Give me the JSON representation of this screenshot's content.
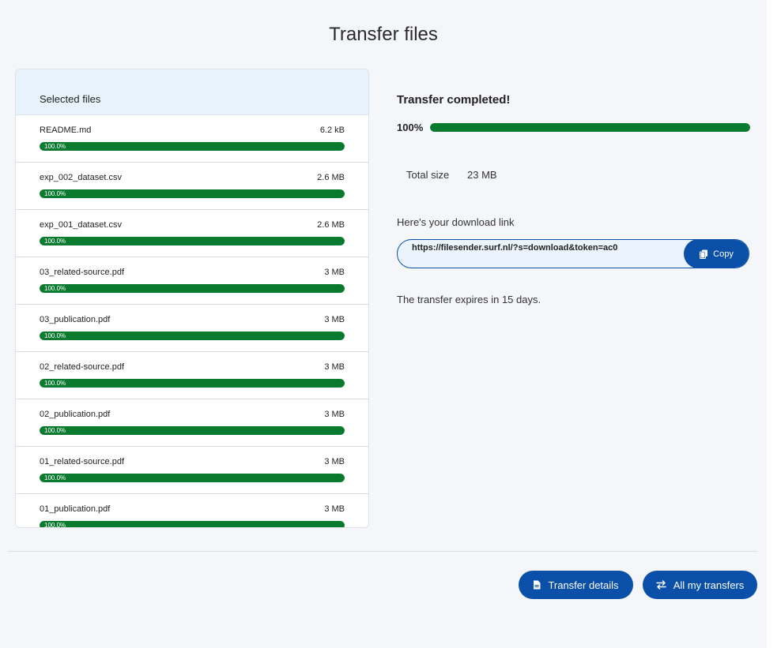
{
  "page": {
    "title": "Transfer files"
  },
  "files_panel": {
    "header": "Selected files",
    "files": [
      {
        "name": "README.md",
        "size": "6.2 kB",
        "progress_label": "100.0%",
        "progress": 1.0
      },
      {
        "name": "exp_002_dataset.csv",
        "size": "2.6 MB",
        "progress_label": "100.0%",
        "progress": 1.0
      },
      {
        "name": "exp_001_dataset.csv",
        "size": "2.6 MB",
        "progress_label": "100.0%",
        "progress": 1.0
      },
      {
        "name": "03_related-source.pdf",
        "size": "3 MB",
        "progress_label": "100.0%",
        "progress": 1.0
      },
      {
        "name": "03_publication.pdf",
        "size": "3 MB",
        "progress_label": "100.0%",
        "progress": 1.0
      },
      {
        "name": "02_related-source.pdf",
        "size": "3 MB",
        "progress_label": "100.0%",
        "progress": 1.0
      },
      {
        "name": "02_publication.pdf",
        "size": "3 MB",
        "progress_label": "100.0%",
        "progress": 1.0
      },
      {
        "name": "01_related-source.pdf",
        "size": "3 MB",
        "progress_label": "100.0%",
        "progress": 1.0
      },
      {
        "name": "01_publication.pdf",
        "size": "3 MB",
        "progress_label": "100.0%",
        "progress": 1.0
      }
    ]
  },
  "status": {
    "title": "Transfer completed!",
    "percent_label": "100%",
    "progress": 1.0,
    "total_size_label": "Total size",
    "total_size_value": "23 MB",
    "link_label": "Here's your download link",
    "link_value": "https://filesender.surf.nl/?s=download&token=ac0",
    "copy_label": "Copy",
    "expires_text": "The transfer expires in 15 days."
  },
  "actions": {
    "transfer_details_label": "Transfer details",
    "all_transfers_label": "All my transfers"
  },
  "colors": {
    "accent": "#0a4fa8",
    "progress": "#0a7a2f",
    "panel_header": "#e8f2fc",
    "background": "#f4f6f9"
  },
  "icons": {
    "copy": "copy-icon",
    "details": "document-icon",
    "transfers": "swap-arrows-icon"
  }
}
